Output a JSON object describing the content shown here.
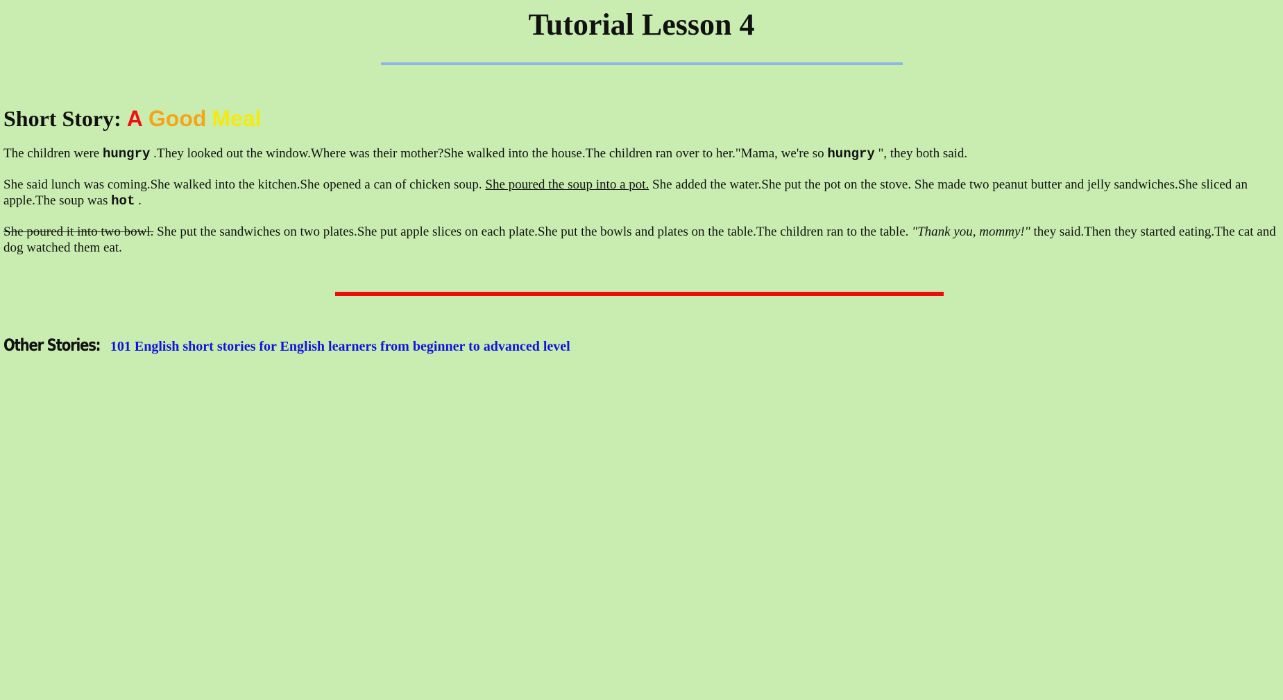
{
  "page": {
    "title": "Tutorial Lesson 4"
  },
  "story": {
    "heading_prefix": "Short Story:",
    "heading_words": [
      "A",
      "Good",
      "Meal"
    ],
    "p1": {
      "t1": "The children were ",
      "k1": "hungry",
      "t2": " .They looked out the window.Where was their mother?She walked into the house.The children ran over to her.\"Mama, we're so ",
      "k2": "hungry",
      "t3": " \", they both said."
    },
    "p2": {
      "t1": "She said lunch was coming.She walked into the kitchen.She opened a can of chicken soup. ",
      "underlined": "She poured the soup into a pot.",
      "t2": " She added the water.She put the pot on the stove. She made two peanut butter and jelly sandwiches.She sliced an apple.The soup was ",
      "k1": "hot",
      "t3": " ."
    },
    "p3": {
      "struck": "She poured it into two bowl.",
      "t1": " She put the sandwiches on two plates.She put apple slices on each plate.She put the bowls and plates on the table.The children ran to the table. ",
      "italic": "\"Thank you, mommy!\"",
      "t2": " they said.Then they started eating.The cat and dog watched them eat."
    }
  },
  "other": {
    "label": "Other Stories:",
    "link_text": "101 English short stories for English learners from beginner to advanced level"
  },
  "colors": {
    "background": "#c9edb0",
    "blue_rule": "#8ab7e6",
    "red_rule": "#f00b0b",
    "word_a": "#f01010",
    "word_good": "#f5a51a",
    "word_meal": "#f2ea10",
    "link": "#1212e0"
  }
}
